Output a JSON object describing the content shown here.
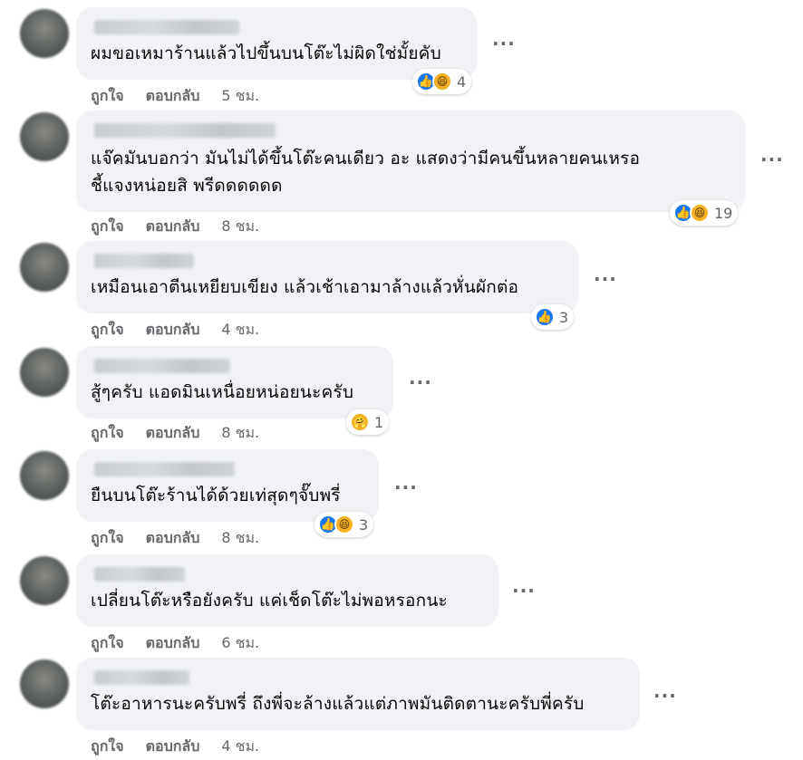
{
  "comments": [
    {
      "text_lines": [
        "ผมขอเหมาร้านแล้วไปขึ้นบนโต๊ะไม่ผิดใช่มั้ยคับ"
      ],
      "reactions": [
        "like",
        "haha"
      ],
      "reaction_count": "4",
      "like_label": "ถูกใจ",
      "reply_label": "ตอบกลับ",
      "time": "5 ชม."
    },
    {
      "text_lines": [
        "แจ๊คมันบอกว่า มันไม่ได้ขึ้นโต๊ะคนเดียว อะ แสดงว่ามีคนขึ้นหลายคนเหรอ",
        "ชี้แจงหน่อยสิ พรีดดดดดด"
      ],
      "reactions": [
        "like",
        "haha"
      ],
      "reaction_count": "19",
      "like_label": "ถูกใจ",
      "reply_label": "ตอบกลับ",
      "time": "8 ชม."
    },
    {
      "text_lines": [
        "เหมือนเอาตีนเหยียบเขียง แล้วเช้าเอามาล้างแล้วหั่นผักต่อ"
      ],
      "reactions": [
        "like"
      ],
      "reaction_count": "3",
      "like_label": "ถูกใจ",
      "reply_label": "ตอบกลับ",
      "time": "4 ชม."
    },
    {
      "text_lines": [
        "สู้ๆครับ แอดมินเหนื่อยหน่อยนะครับ"
      ],
      "reactions": [
        "care"
      ],
      "reaction_count": "1",
      "like_label": "ถูกใจ",
      "reply_label": "ตอบกลับ",
      "time": "8 ชม."
    },
    {
      "text_lines": [
        "ยืนบนโต๊ะร้านได้ด้วยเท่สุดๆจั๊บพรี่"
      ],
      "reactions": [
        "like",
        "haha"
      ],
      "reaction_count": "3",
      "like_label": "ถูกใจ",
      "reply_label": "ตอบกลับ",
      "time": "8 ชม."
    },
    {
      "text_lines": [
        "เปลี่ยนโต๊ะหรือยังครับ แค่เช็ดโต๊ะไม่พอหรอกนะ"
      ],
      "reactions": [],
      "reaction_count": "",
      "like_label": "ถูกใจ",
      "reply_label": "ตอบกลับ",
      "time": "6 ชม."
    },
    {
      "text_lines": [
        "โต๊ะอาหารนะครับพรี่ ถึงพี่จะล้างแล้วแต่ภาพมันติดตานะครับพี่ครับ"
      ],
      "reactions": [],
      "reaction_count": "",
      "like_label": "ถูกใจ",
      "reply_label": "ตอบกลับ",
      "time": "4 ชม."
    }
  ],
  "icons": {
    "more": "more-options-icon",
    "like": "like-reaction-icon",
    "haha": "haha-reaction-icon",
    "care": "care-reaction-icon"
  },
  "more_label": "···",
  "colors": {
    "bubble": "#f0f2f5",
    "like": "#1877f2",
    "emoji": "#f7b125",
    "meta": "#65676b"
  }
}
